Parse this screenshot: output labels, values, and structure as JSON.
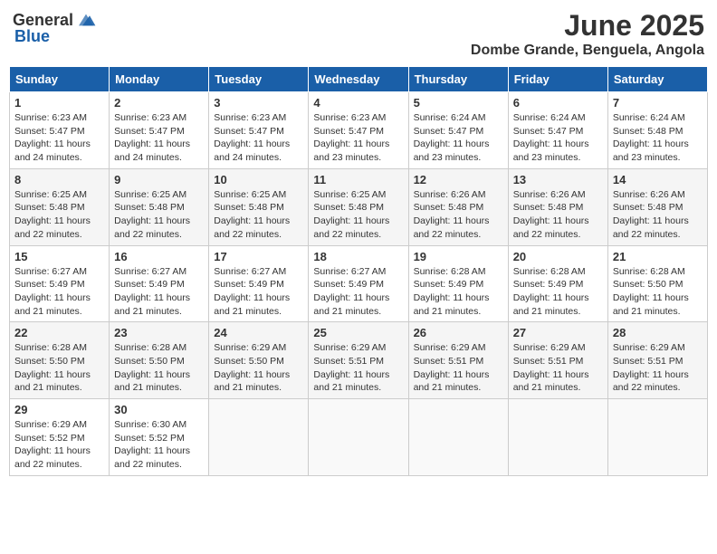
{
  "header": {
    "logo_general": "General",
    "logo_blue": "Blue",
    "month_title": "June 2025",
    "location": "Dombe Grande, Benguela, Angola"
  },
  "weekdays": [
    "Sunday",
    "Monday",
    "Tuesday",
    "Wednesday",
    "Thursday",
    "Friday",
    "Saturday"
  ],
  "weeks": [
    [
      {
        "day": "1",
        "info": "Sunrise: 6:23 AM\nSunset: 5:47 PM\nDaylight: 11 hours\nand 24 minutes."
      },
      {
        "day": "2",
        "info": "Sunrise: 6:23 AM\nSunset: 5:47 PM\nDaylight: 11 hours\nand 24 minutes."
      },
      {
        "day": "3",
        "info": "Sunrise: 6:23 AM\nSunset: 5:47 PM\nDaylight: 11 hours\nand 24 minutes."
      },
      {
        "day": "4",
        "info": "Sunrise: 6:23 AM\nSunset: 5:47 PM\nDaylight: 11 hours\nand 23 minutes."
      },
      {
        "day": "5",
        "info": "Sunrise: 6:24 AM\nSunset: 5:47 PM\nDaylight: 11 hours\nand 23 minutes."
      },
      {
        "day": "6",
        "info": "Sunrise: 6:24 AM\nSunset: 5:47 PM\nDaylight: 11 hours\nand 23 minutes."
      },
      {
        "day": "7",
        "info": "Sunrise: 6:24 AM\nSunset: 5:48 PM\nDaylight: 11 hours\nand 23 minutes."
      }
    ],
    [
      {
        "day": "8",
        "info": "Sunrise: 6:25 AM\nSunset: 5:48 PM\nDaylight: 11 hours\nand 22 minutes."
      },
      {
        "day": "9",
        "info": "Sunrise: 6:25 AM\nSunset: 5:48 PM\nDaylight: 11 hours\nand 22 minutes."
      },
      {
        "day": "10",
        "info": "Sunrise: 6:25 AM\nSunset: 5:48 PM\nDaylight: 11 hours\nand 22 minutes."
      },
      {
        "day": "11",
        "info": "Sunrise: 6:25 AM\nSunset: 5:48 PM\nDaylight: 11 hours\nand 22 minutes."
      },
      {
        "day": "12",
        "info": "Sunrise: 6:26 AM\nSunset: 5:48 PM\nDaylight: 11 hours\nand 22 minutes."
      },
      {
        "day": "13",
        "info": "Sunrise: 6:26 AM\nSunset: 5:48 PM\nDaylight: 11 hours\nand 22 minutes."
      },
      {
        "day": "14",
        "info": "Sunrise: 6:26 AM\nSunset: 5:48 PM\nDaylight: 11 hours\nand 22 minutes."
      }
    ],
    [
      {
        "day": "15",
        "info": "Sunrise: 6:27 AM\nSunset: 5:49 PM\nDaylight: 11 hours\nand 21 minutes."
      },
      {
        "day": "16",
        "info": "Sunrise: 6:27 AM\nSunset: 5:49 PM\nDaylight: 11 hours\nand 21 minutes."
      },
      {
        "day": "17",
        "info": "Sunrise: 6:27 AM\nSunset: 5:49 PM\nDaylight: 11 hours\nand 21 minutes."
      },
      {
        "day": "18",
        "info": "Sunrise: 6:27 AM\nSunset: 5:49 PM\nDaylight: 11 hours\nand 21 minutes."
      },
      {
        "day": "19",
        "info": "Sunrise: 6:28 AM\nSunset: 5:49 PM\nDaylight: 11 hours\nand 21 minutes."
      },
      {
        "day": "20",
        "info": "Sunrise: 6:28 AM\nSunset: 5:49 PM\nDaylight: 11 hours\nand 21 minutes."
      },
      {
        "day": "21",
        "info": "Sunrise: 6:28 AM\nSunset: 5:50 PM\nDaylight: 11 hours\nand 21 minutes."
      }
    ],
    [
      {
        "day": "22",
        "info": "Sunrise: 6:28 AM\nSunset: 5:50 PM\nDaylight: 11 hours\nand 21 minutes."
      },
      {
        "day": "23",
        "info": "Sunrise: 6:28 AM\nSunset: 5:50 PM\nDaylight: 11 hours\nand 21 minutes."
      },
      {
        "day": "24",
        "info": "Sunrise: 6:29 AM\nSunset: 5:50 PM\nDaylight: 11 hours\nand 21 minutes."
      },
      {
        "day": "25",
        "info": "Sunrise: 6:29 AM\nSunset: 5:51 PM\nDaylight: 11 hours\nand 21 minutes."
      },
      {
        "day": "26",
        "info": "Sunrise: 6:29 AM\nSunset: 5:51 PM\nDaylight: 11 hours\nand 21 minutes."
      },
      {
        "day": "27",
        "info": "Sunrise: 6:29 AM\nSunset: 5:51 PM\nDaylight: 11 hours\nand 21 minutes."
      },
      {
        "day": "28",
        "info": "Sunrise: 6:29 AM\nSunset: 5:51 PM\nDaylight: 11 hours\nand 22 minutes."
      }
    ],
    [
      {
        "day": "29",
        "info": "Sunrise: 6:29 AM\nSunset: 5:52 PM\nDaylight: 11 hours\nand 22 minutes."
      },
      {
        "day": "30",
        "info": "Sunrise: 6:30 AM\nSunset: 5:52 PM\nDaylight: 11 hours\nand 22 minutes."
      },
      {
        "day": "",
        "info": ""
      },
      {
        "day": "",
        "info": ""
      },
      {
        "day": "",
        "info": ""
      },
      {
        "day": "",
        "info": ""
      },
      {
        "day": "",
        "info": ""
      }
    ]
  ]
}
